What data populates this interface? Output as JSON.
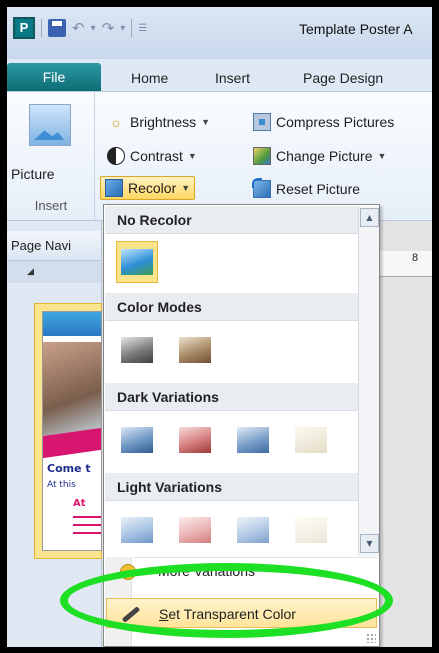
{
  "window": {
    "app_icon_letter": "P",
    "title": "Template Poster A"
  },
  "tabs": [
    {
      "label": "File"
    },
    {
      "label": "Home"
    },
    {
      "label": "Insert"
    },
    {
      "label": "Page Design"
    }
  ],
  "ribbon": {
    "picture_label": "Picture",
    "insert_group_label": "Insert",
    "brightness_label": "Brightness",
    "contrast_label": "Contrast",
    "recolor_label": "Recolor",
    "compress_label": "Compress Pictures",
    "change_picture_label": "Change Picture",
    "reset_picture_label": "Reset Picture"
  },
  "nav": {
    "header": "Page Navi",
    "thumb_text_come": "Come t",
    "thumb_text_atthis": "At this",
    "thumb_text_at": "At"
  },
  "ruler": {
    "mark": "8"
  },
  "recolor_menu": {
    "sections": [
      {
        "title": "No Recolor"
      },
      {
        "title": "Color Modes"
      },
      {
        "title": "Dark Variations"
      },
      {
        "title": "Light Variations"
      }
    ],
    "more_variations_label": "More Variations",
    "set_transparent_prefix": "S",
    "set_transparent_rest": "et Transparent Color"
  },
  "colors": {
    "highlight_ring": "#1de025",
    "file_tab": "#1b818a",
    "hover_fill": "#ffe39a"
  }
}
